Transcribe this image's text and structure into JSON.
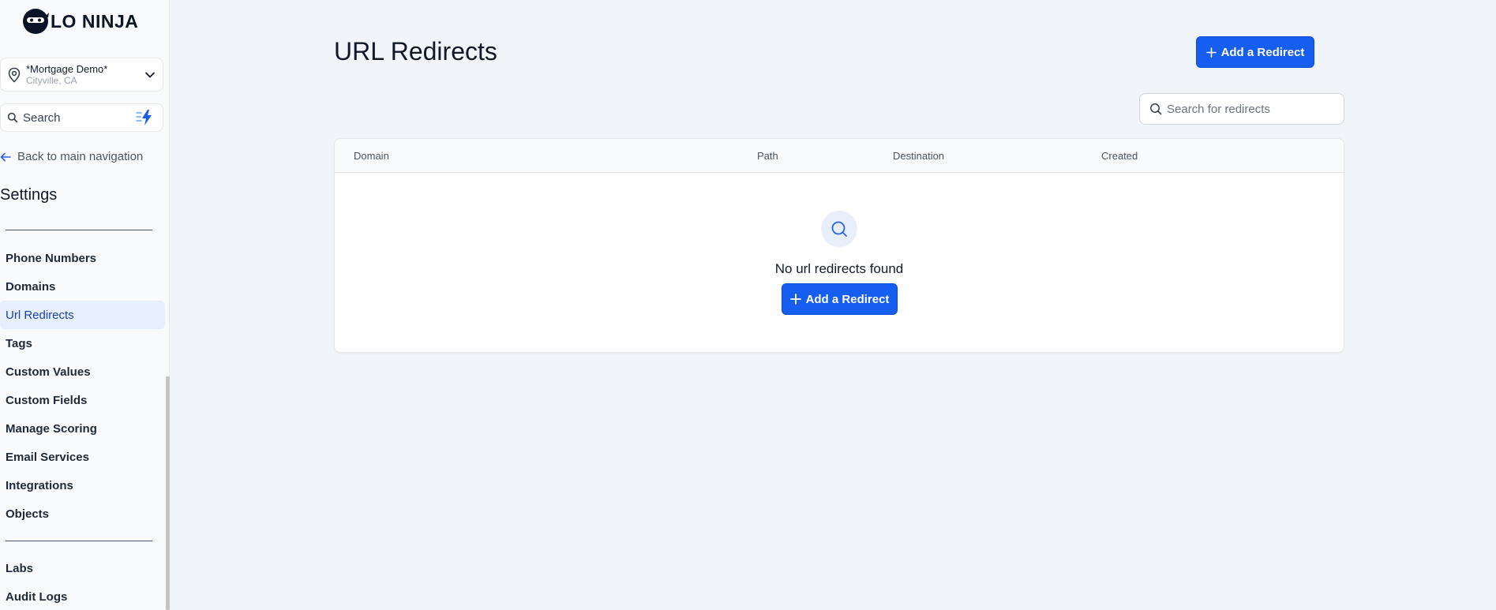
{
  "brand": {
    "logo_text": "LO NINJA"
  },
  "location": {
    "name": "*Mortgage Demo*",
    "city": "Cityville, CA"
  },
  "sidebar_search": {
    "label": "Search"
  },
  "back_link": "Back to main navigation",
  "settings_title": "Settings",
  "nav_group1": [
    {
      "label": "Phone Numbers"
    },
    {
      "label": "Domains"
    },
    {
      "label": "Url Redirects",
      "active": true
    },
    {
      "label": "Tags"
    },
    {
      "label": "Custom Values"
    },
    {
      "label": "Custom Fields"
    },
    {
      "label": "Manage Scoring"
    },
    {
      "label": "Email Services"
    },
    {
      "label": "Integrations"
    },
    {
      "label": "Objects"
    }
  ],
  "nav_group2": [
    {
      "label": "Labs"
    },
    {
      "label": "Audit Logs"
    }
  ],
  "page": {
    "title": "URL Redirects",
    "add_button": "Add a Redirect",
    "search_placeholder": "Search for redirects"
  },
  "table": {
    "columns": [
      "Domain",
      "Path",
      "Destination",
      "Created"
    ],
    "empty_text": "No url redirects found",
    "empty_button": "Add a Redirect"
  },
  "colors": {
    "primary": "#155eef",
    "active_bg": "#e6effc",
    "active_text": "#1e40af"
  }
}
